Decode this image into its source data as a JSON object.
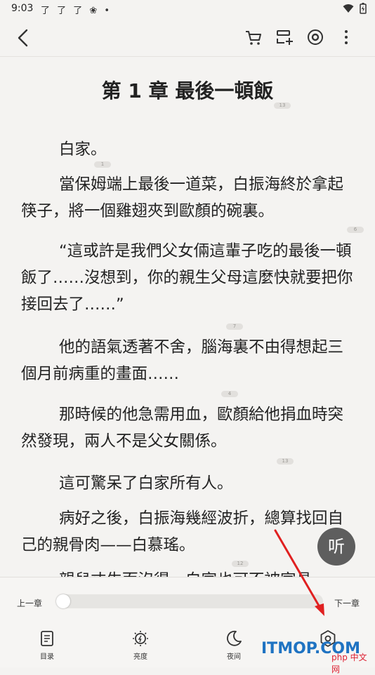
{
  "status": {
    "time": "9:03",
    "left_icons": "了 了 了 ❀ •"
  },
  "chapter": {
    "title": "第 1 章 最後一頓飯",
    "title_comments": "13"
  },
  "paragraphs": [
    {
      "text": "白家。",
      "comments": "1"
    },
    {
      "text": "當保姆端上最後一道菜，白振海終於拿起筷子，將一個雞翅夾到歐顏的碗裏。",
      "comments": "6"
    },
    {
      "text": "“這或許是我們父女倆這輩子吃的最後一頓飯了……沒想到，你的親生父母這麼快就要把你接回去了……”",
      "comments": "7"
    },
    {
      "text": "他的語氣透著不舍，腦海裏不由得想起三個月前病重的畫面……",
      "comments": "4"
    },
    {
      "text": "那時候的他急需用血，歐顏給他捐血時突然發現，兩人不是父女關係。",
      "comments": "13"
    },
    {
      "text": "這可驚呆了白家所有人。",
      "comments": ""
    },
    {
      "text": "病好之後，白振海幾經波折，總算找回自己的親骨肉——白慕瑤。",
      "comments": "12"
    },
    {
      "text": "親兒丈生而沒得，白家也可不被家具",
      "comments": ""
    }
  ],
  "listen_label": "听",
  "controls": {
    "prev_chapter": "上一章",
    "next_chapter": "下一章",
    "progress": 0.0
  },
  "bottom_nav": [
    {
      "label": "目录",
      "icon": "toc-icon"
    },
    {
      "label": "亮度",
      "icon": "brightness-icon"
    },
    {
      "label": "夜间",
      "icon": "moon-icon"
    },
    {
      "label": "",
      "icon": "settings-icon"
    }
  ],
  "watermark": {
    "text": "ITMOP.COM",
    "sub": "php 中文网"
  },
  "colors": {
    "background": "#f4f3f1",
    "listen_button": "#5e5e5e",
    "watermark": "#1f73c2",
    "arrow": "#e02020"
  }
}
